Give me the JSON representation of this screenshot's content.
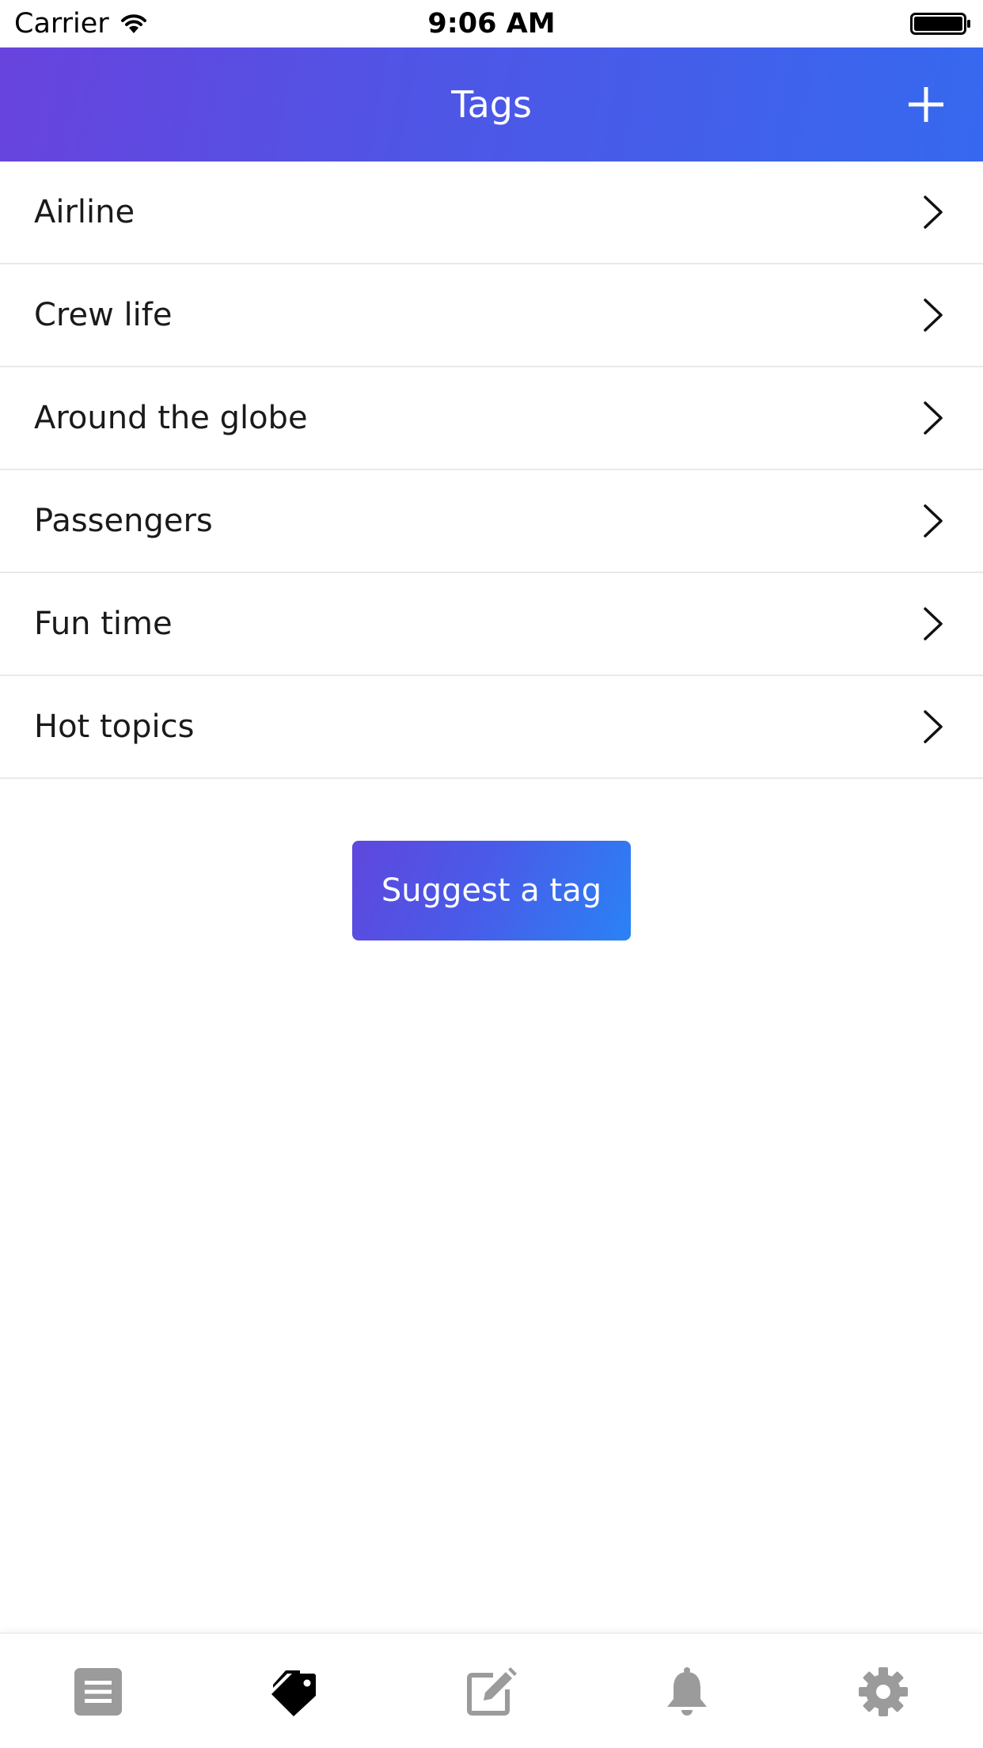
{
  "status_bar": {
    "carrier": "Carrier",
    "time": "9:06 AM"
  },
  "header": {
    "title": "Tags",
    "add_icon": "plus-icon"
  },
  "tags": [
    {
      "label": "Airline"
    },
    {
      "label": "Crew life"
    },
    {
      "label": "Around the globe"
    },
    {
      "label": "Passengers"
    },
    {
      "label": "Fun time"
    },
    {
      "label": "Hot topics"
    }
  ],
  "suggest_button": {
    "label": "Suggest a tag"
  },
  "tab_bar": {
    "tabs": [
      {
        "icon": "list-icon",
        "active": false
      },
      {
        "icon": "tag-icon",
        "active": true
      },
      {
        "icon": "compose-icon",
        "active": false
      },
      {
        "icon": "bell-icon",
        "active": false
      },
      {
        "icon": "gear-icon",
        "active": false
      }
    ],
    "active_color": "#000000",
    "inactive_color": "#9b9b9b"
  },
  "colors": {
    "header_gradient_start": "#6843dd",
    "header_gradient_end": "#3669ef",
    "button_gradient_start": "#5f47dd",
    "button_gradient_end": "#2a82f5"
  }
}
